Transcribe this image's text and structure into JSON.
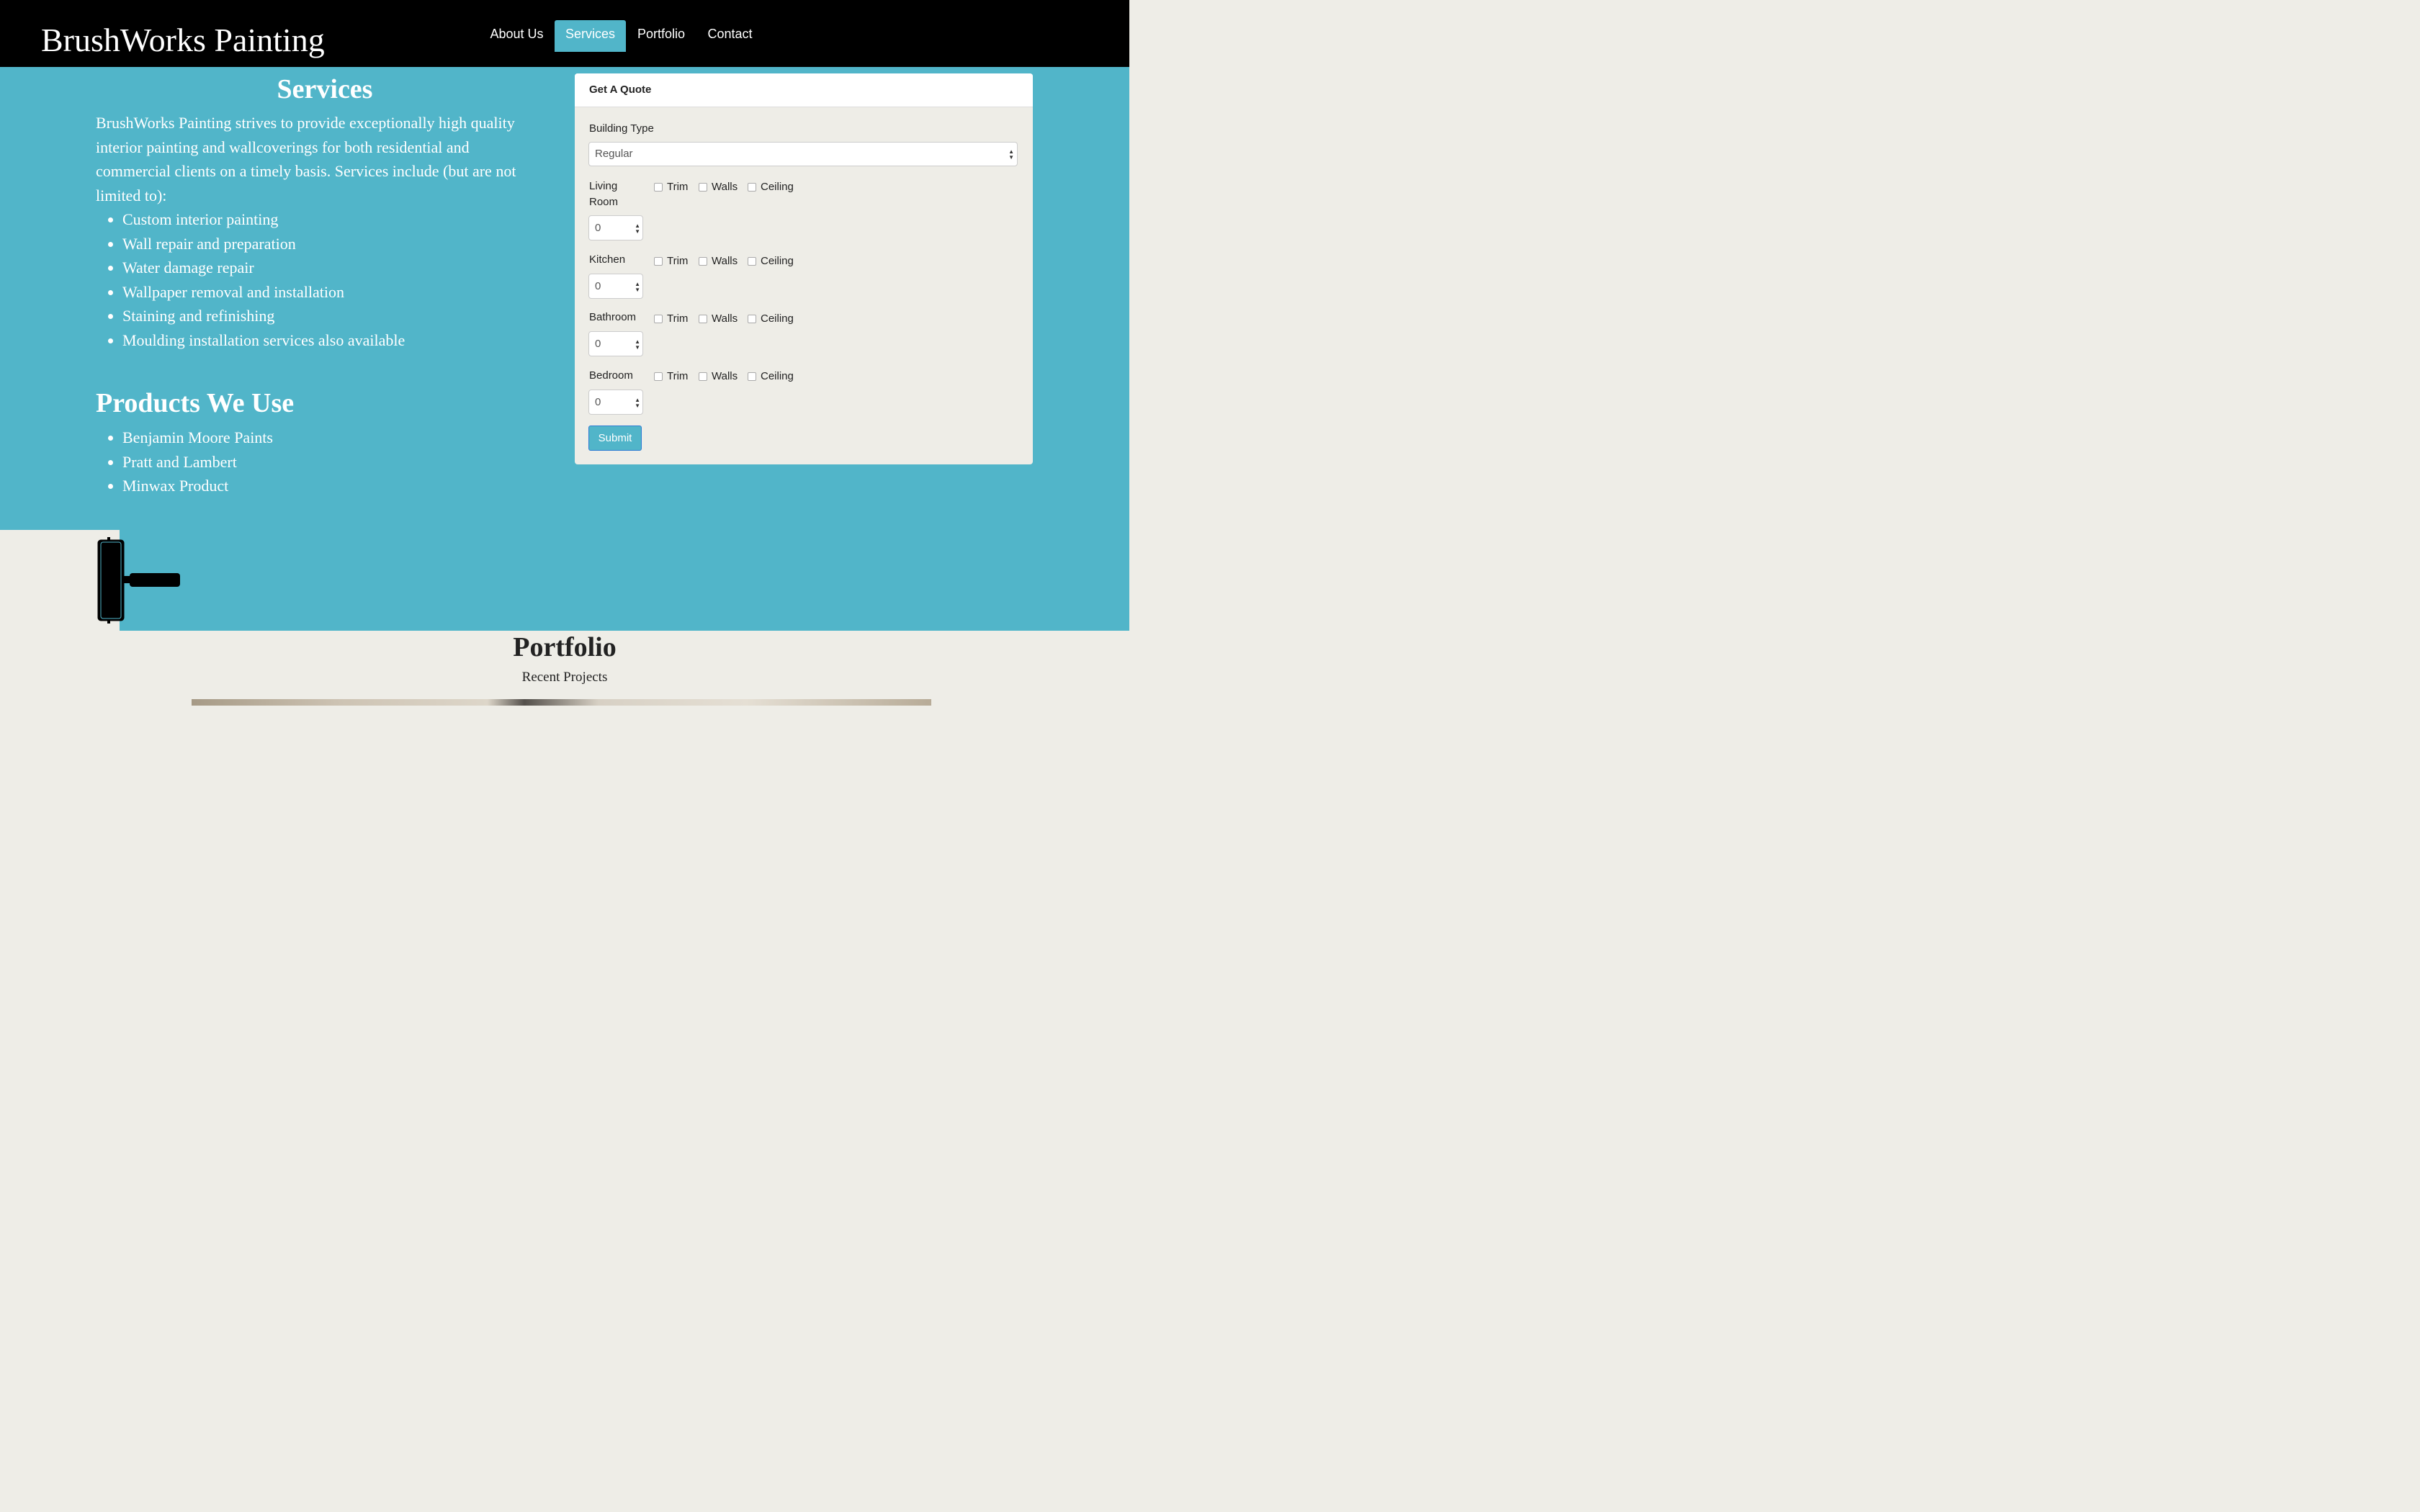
{
  "navbar": {
    "brand": "BrushWorks Painting",
    "items": [
      {
        "label": "About Us",
        "active": false
      },
      {
        "label": "Services",
        "active": true
      },
      {
        "label": "Portfolio",
        "active": false
      },
      {
        "label": "Contact",
        "active": false
      }
    ]
  },
  "services": {
    "title": "Services",
    "description": "BrushWorks Painting strives to provide exceptionally high quality interior painting and wallcoverings for both residential and commercial clients on a timely basis. Services include (but are not limited to):",
    "items": [
      "Custom interior painting",
      "Wall repair and preparation",
      "Water damage repair",
      "Wallpaper removal and installation",
      "Staining and refinishing",
      "Moulding installation services also available"
    ]
  },
  "products": {
    "title": "Products We Use",
    "items": [
      "Benjamin Moore Paints",
      "Pratt and Lambert",
      "Minwax Product"
    ]
  },
  "quote": {
    "title": "Get A Quote",
    "building_type_label": "Building Type",
    "building_type_value": "Regular",
    "rooms": [
      {
        "name": "Living Room",
        "count": "0"
      },
      {
        "name": "Kitchen",
        "count": "0"
      },
      {
        "name": "Bathroom",
        "count": "0"
      },
      {
        "name": "Bedroom",
        "count": "0"
      }
    ],
    "options": [
      "Trim",
      "Walls",
      "Ceiling"
    ],
    "submit_label": "Submit"
  },
  "portfolio": {
    "title": "Portfolio",
    "subtitle": "Recent Projects"
  },
  "colors": {
    "teal": "#51b5c9",
    "navbar": "#000000",
    "panel_bg": "#eeede7"
  }
}
